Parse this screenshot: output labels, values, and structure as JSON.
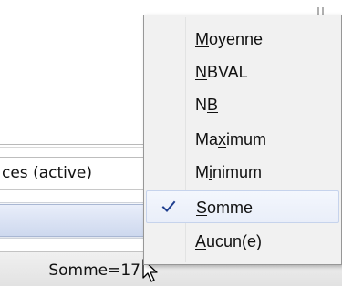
{
  "sheet_tab": {
    "label": "ces (active)"
  },
  "status_bar": {
    "sum_text": "Somme=17"
  },
  "menu": {
    "items": [
      {
        "pre": "",
        "key": "M",
        "post": "oyenne",
        "checked": false
      },
      {
        "pre": "",
        "key": "N",
        "post": "BVAL",
        "checked": false
      },
      {
        "pre": "N",
        "key": "B",
        "post": "",
        "checked": false
      },
      {
        "pre": "Ma",
        "key": "x",
        "post": "imum",
        "checked": false
      },
      {
        "pre": "M",
        "key": "i",
        "post": "nimum",
        "checked": false
      },
      {
        "pre": "",
        "key": "S",
        "post": "omme",
        "checked": true
      },
      {
        "pre": "",
        "key": "A",
        "post": "ucun(e)",
        "checked": false
      }
    ]
  },
  "colors": {
    "check": "#1f3f8f",
    "menu_bg": "#f1f1f1",
    "highlight_border": "#c6d3ec"
  }
}
